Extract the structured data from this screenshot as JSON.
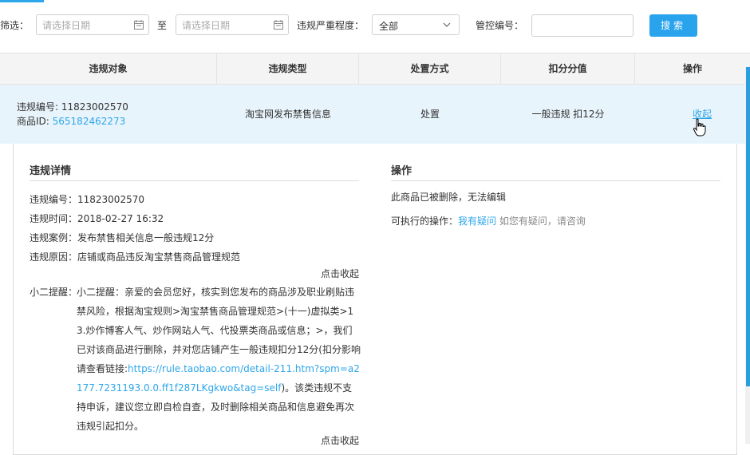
{
  "filters": {
    "screen_label": "筛选：",
    "date_start_placeholder": "请选择日期",
    "to_label": "至",
    "date_end_placeholder": "请选择日期",
    "severity_label": "违规严重程度：",
    "severity_value": "全部",
    "control_no_label": "管控编号：",
    "control_no_value": "",
    "search_label": "搜索"
  },
  "table": {
    "headers": [
      "违规对象",
      "违规类型",
      "处置方式",
      "扣分分值",
      "操作"
    ],
    "row": {
      "violation_no": "违规编号: 11823002570",
      "product_id_label": "商品ID: ",
      "product_id": "565182462273",
      "type": "淘宝网发布禁售信息",
      "handling": "处置",
      "points": "一般违规 扣12分",
      "action": "收起"
    }
  },
  "detail": {
    "title": "违规详情",
    "no": "违规编号：11823002570",
    "time": "违规时间：2018-02-27 16:32",
    "case": "违规案例：发布禁售相关信息一般违规12分",
    "reason": "违规原因：店铺或商品违反淘宝禁售商品管理规范",
    "collapse_1": "点击收起",
    "reminder_label": "小二提醒：",
    "reminder_text_1": "小二提醒：亲爱的会员您好，核实到您发布的商品涉及职业刷贴违禁风险，根据淘宝规则>淘宝禁售商品管理规范>(十一)虚拟类>13.炒作博客人气、炒作网站人气、代投票类商品或信息；>，我们已对该商品进行删除，并对您店铺产生一般违规扣分12分(扣分影响请查看链接:",
    "reminder_link": "https://rule.taobao.com/detail-211.htm?spm=a2177.7231193.0.0.ff1f287LKgkwo&tag=self",
    "reminder_text_2": ")。该类违规不支持申诉，建议您立即自检自查，及时删除相关商品和信息避免再次违规引起扣分。",
    "collapse_2": "点击收起"
  },
  "operation": {
    "title": "操作",
    "status": "此商品已被删除，无法编辑",
    "available_label": "可执行的操作：",
    "doubt_link": "我有疑问",
    "doubt_hint": " 如您有疑问，请咨询"
  },
  "colors": {
    "accent": "#2ea6ea",
    "button": "#29a3ec",
    "row_highlight": "#e8f4fb"
  }
}
